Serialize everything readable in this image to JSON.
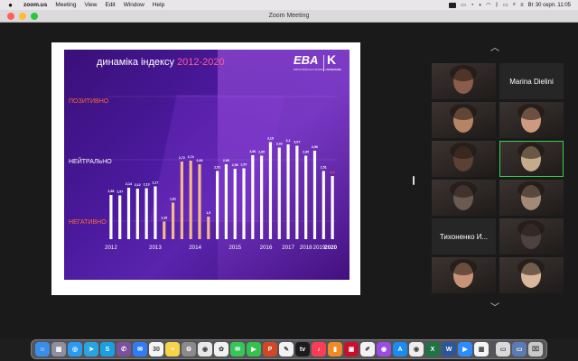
{
  "menubar": {
    "app_name": "zoom.us",
    "items": [
      "Meeting",
      "View",
      "Edit",
      "Window",
      "Help"
    ],
    "clock": "Вт 30 серп.  11:05"
  },
  "window": {
    "title": "Zoom Meeting"
  },
  "slide": {
    "title_prefix": "динаміка індексу",
    "title_years": "2012-2020",
    "logo_main": "EBA",
    "logo_sub": "ЄВРОПЕЙСЬКА БІЗНЕС АСОЦІАЦІЯ",
    "logo_partner": "K",
    "logo_partner_sub": "VASIL KISIL"
  },
  "chart_data": {
    "type": "bar",
    "zones": [
      "ПОЗИТИВНО",
      "НЕЙТРАЛЬНО",
      "НЕГАТИВНО"
    ],
    "years": [
      "2012",
      "2013",
      "2014",
      "2015",
      "2016",
      "2017",
      "2018",
      "2019",
      "2020"
    ],
    "values": [
      1.98,
      1.97,
      2.14,
      2.12,
      2.13,
      2.17,
      1.39,
      1.81,
      2.72,
      2.74,
      2.66,
      1.5,
      2.51,
      2.66,
      2.56,
      2.57,
      2.86,
      2.85,
      3.15,
      3.03,
      3.1,
      3.07,
      2.85,
      2.96,
      2.51,
      2.4
    ],
    "value_labels": [
      "1,98",
      "1,97",
      "2,14",
      "2,12",
      "2,13",
      "2,17",
      "1,39",
      "1,81",
      "2,72",
      "2,74",
      "2,66",
      "1,5",
      "2,51",
      "2,66",
      "2,56",
      "2,57",
      "2,86",
      "2,85",
      "3,15",
      "3,03",
      "3,1",
      "3,07",
      "2,85",
      "2,96",
      "2,51",
      "2,4"
    ],
    "highlight_color": "#f5b98a",
    "bar_color": "#ffffff",
    "last_color": "#ff5a3c"
  },
  "participants": [
    {
      "type": "video",
      "tone": "#8a5c4b"
    },
    {
      "type": "name",
      "label": "Marina Dielini"
    },
    {
      "type": "video",
      "tone": "#b58465"
    },
    {
      "type": "video",
      "tone": "#cc9a7e"
    },
    {
      "type": "video",
      "tone": "#5a4136"
    },
    {
      "type": "video",
      "tone": "#c6ab8a",
      "active": true
    },
    {
      "type": "video",
      "tone": "#6b5a52"
    },
    {
      "type": "video",
      "tone": "#a38a76"
    },
    {
      "type": "name",
      "label": "Тихоненко И..."
    },
    {
      "type": "video",
      "tone": "#4e4240"
    },
    {
      "type": "video",
      "tone": "#c79277"
    },
    {
      "type": "video",
      "tone": "#d8b79b"
    }
  ],
  "dock": {
    "apps": [
      {
        "name": "finder",
        "color": "#3a8ee8",
        "glyph": "☺"
      },
      {
        "name": "launchpad",
        "color": "#8f8fa0",
        "glyph": "▦"
      },
      {
        "name": "safari",
        "color": "#2b9af3",
        "glyph": "◎"
      },
      {
        "name": "telegram",
        "color": "#2aa3e0",
        "glyph": "➤"
      },
      {
        "name": "skype",
        "color": "#1a9fe0",
        "glyph": "S"
      },
      {
        "name": "viber",
        "color": "#7b519d",
        "glyph": "✆"
      },
      {
        "name": "messenger",
        "color": "#2f7df6",
        "glyph": "✉"
      },
      {
        "name": "calendar",
        "color": "#f4f4f4",
        "glyph": "30"
      },
      {
        "name": "notes",
        "color": "#f7d34a",
        "glyph": "≡"
      },
      {
        "name": "settings",
        "color": "#8a8a8a",
        "glyph": "⚙"
      },
      {
        "name": "chrome",
        "color": "#e8e8e8",
        "glyph": "◉"
      },
      {
        "name": "photos",
        "color": "#f0f0f0",
        "glyph": "✿"
      },
      {
        "name": "messages",
        "color": "#36c759",
        "glyph": "✉"
      },
      {
        "name": "facetime",
        "color": "#34c24f",
        "glyph": "▶"
      },
      {
        "name": "powerpoint",
        "color": "#d24726",
        "glyph": "P"
      },
      {
        "name": "notes-app",
        "color": "#f2f2f2",
        "glyph": "✎"
      },
      {
        "name": "appletv",
        "color": "#1c1c1c",
        "glyph": "tv"
      },
      {
        "name": "music",
        "color": "#fa3c55",
        "glyph": "♪"
      },
      {
        "name": "books",
        "color": "#f08a24",
        "glyph": "▮"
      },
      {
        "name": "photobooth",
        "color": "#c8102e",
        "glyph": "▣"
      },
      {
        "name": "pages",
        "color": "#f2f2f2",
        "glyph": "✐"
      },
      {
        "name": "podcasts",
        "color": "#9b4de0",
        "glyph": "◉"
      },
      {
        "name": "appstore",
        "color": "#1a8cf0",
        "glyph": "A"
      },
      {
        "name": "chrome-2",
        "color": "#ededed",
        "glyph": "◉"
      },
      {
        "name": "excel",
        "color": "#1f7244",
        "glyph": "X"
      },
      {
        "name": "word",
        "color": "#2b579a",
        "glyph": "W"
      },
      {
        "name": "zoom",
        "color": "#2d8cff",
        "glyph": "▶"
      },
      {
        "name": "calendar-2",
        "color": "#f4f4f4",
        "glyph": "▦"
      },
      {
        "name": "preview",
        "color": "#d9d9d9",
        "glyph": "▭"
      },
      {
        "name": "window-thumb",
        "color": "#5b7bb3",
        "glyph": "▭"
      },
      {
        "name": "trash",
        "color": "#c9c9c9",
        "glyph": "⌧"
      }
    ]
  },
  "colors": {
    "active_speaker": "#3ccf4e",
    "zone_positive": "#ff6b2d",
    "zone_negative": "#ff6b2d",
    "zone_neutral": "#ffffff"
  }
}
